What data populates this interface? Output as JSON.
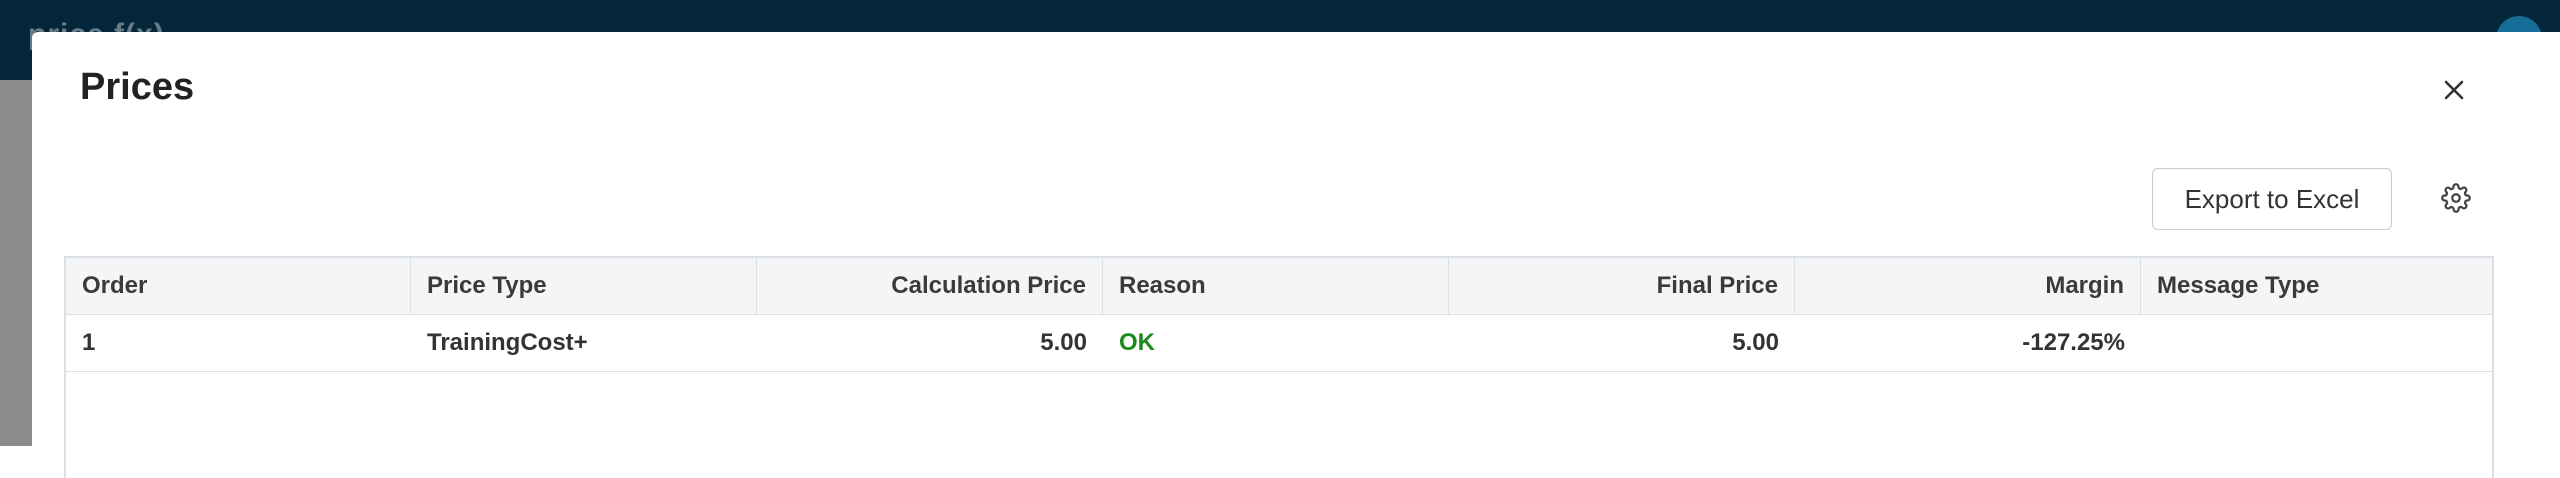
{
  "app": {
    "logo_text": "price f(x)"
  },
  "modal": {
    "title": "Prices",
    "close_icon": "close-icon",
    "export_button_label": "Export to Excel",
    "settings_icon": "gear-icon"
  },
  "table": {
    "columns": [
      {
        "label": "Order",
        "align": "left"
      },
      {
        "label": "Price Type",
        "align": "left"
      },
      {
        "label": "Calculation Price",
        "align": "right"
      },
      {
        "label": "Reason",
        "align": "left"
      },
      {
        "label": "Final Price",
        "align": "right"
      },
      {
        "label": "Margin",
        "align": "right"
      },
      {
        "label": "Message Type",
        "align": "left"
      }
    ],
    "rows": [
      {
        "order": "1",
        "price_type": "TrainingCost+",
        "calculation_price": "5.00",
        "reason": "OK",
        "final_price": "5.00",
        "margin": "-127.25%",
        "message_type": ""
      }
    ]
  },
  "colors": {
    "app_bar": "#03263a",
    "backdrop": "#8c8c8c",
    "status_ok": "#1a8a1a"
  }
}
